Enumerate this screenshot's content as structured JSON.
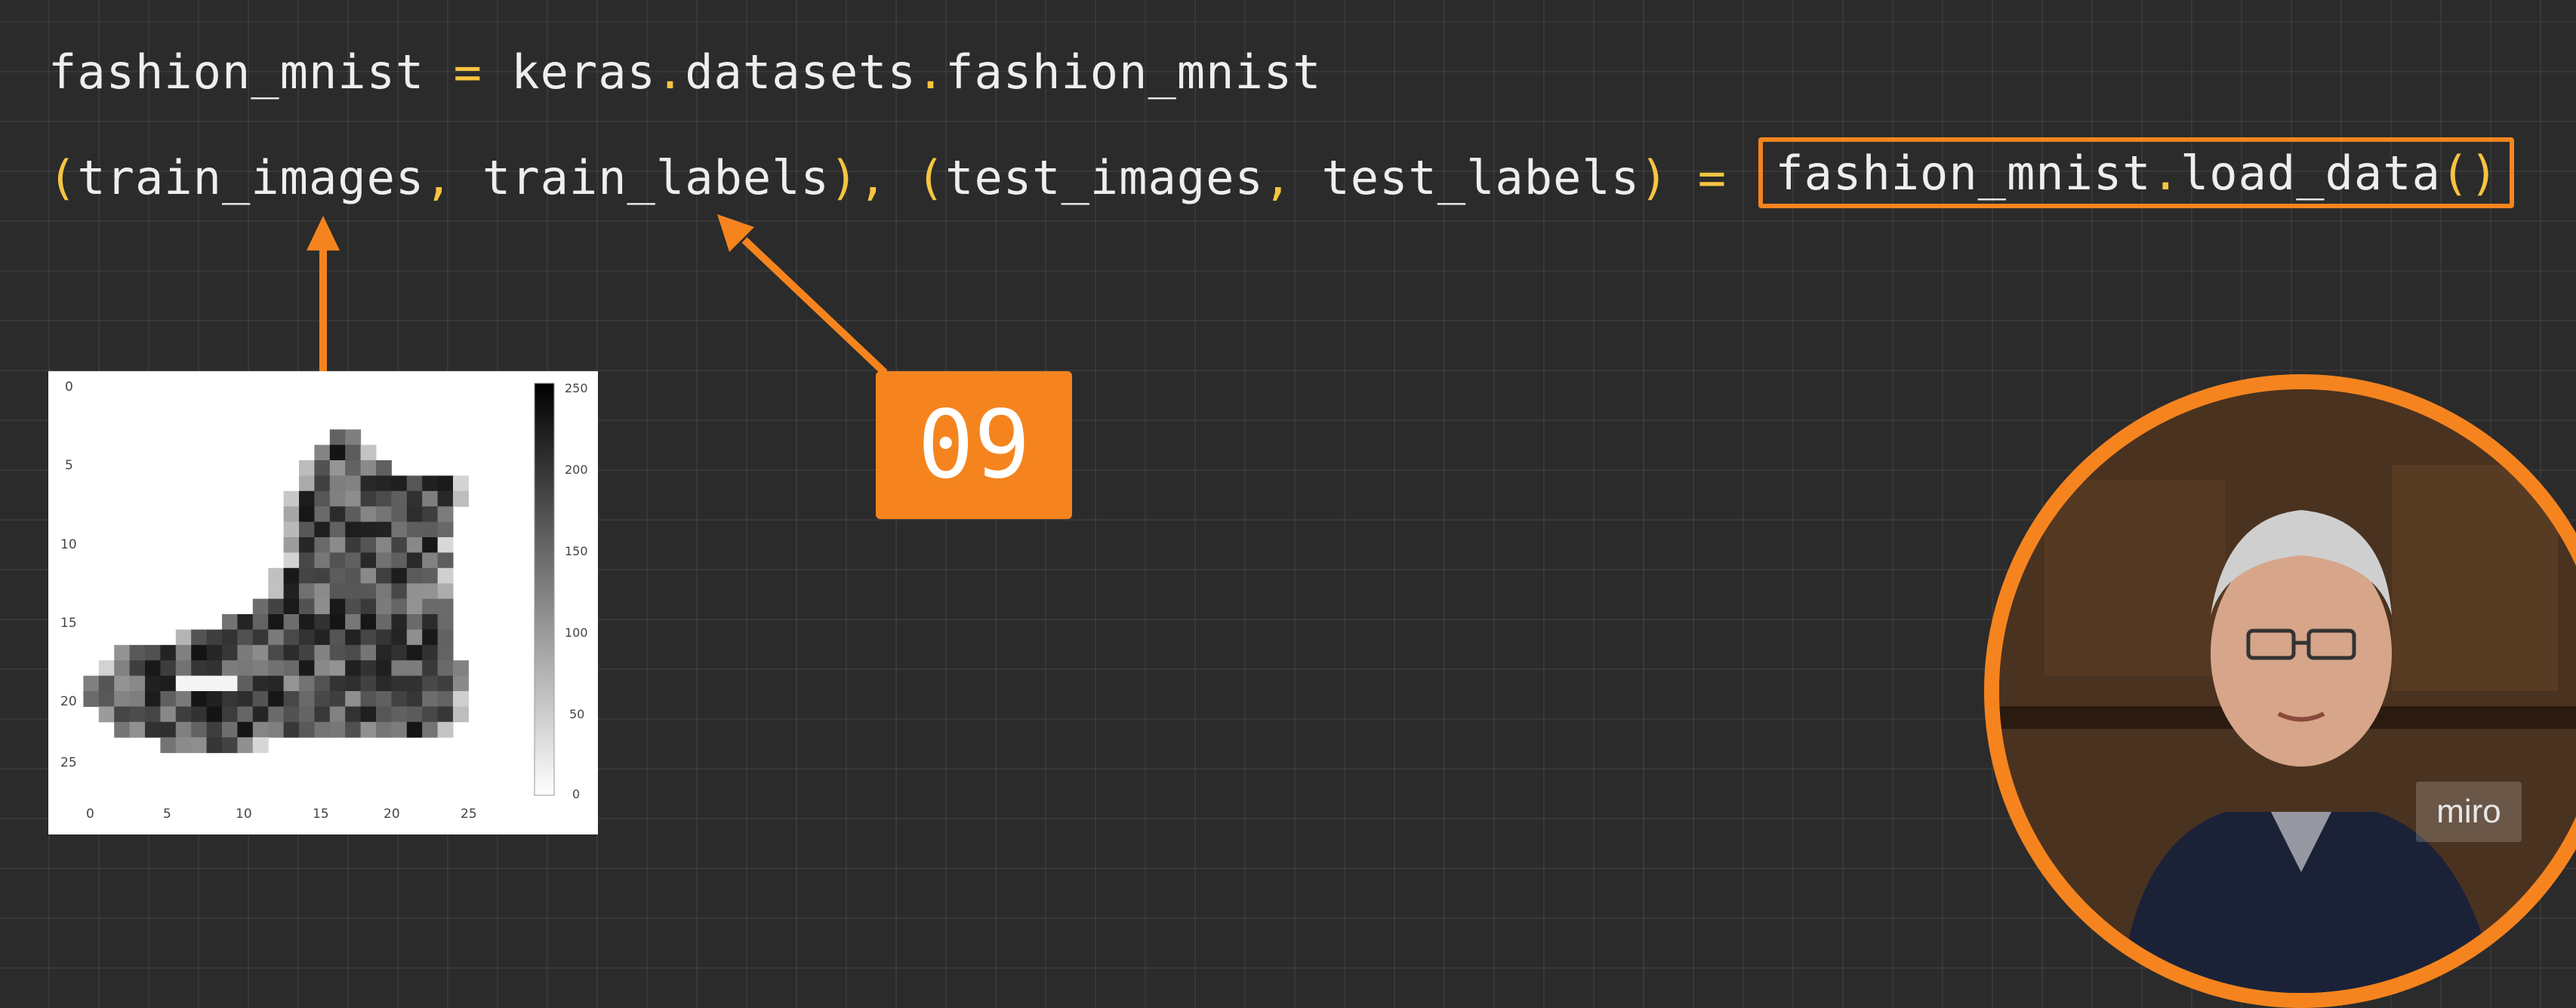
{
  "code": {
    "line1": {
      "var": "fashion_mnist",
      "eq": "=",
      "mod1": "keras",
      "dot": ".",
      "mod2": "datasets",
      "attr": "fashion_mnist"
    },
    "line2": {
      "open_paren": "(",
      "close_paren": ")",
      "comma": ",",
      "train_images": "train_images",
      "train_labels": "train_labels",
      "test_images": "test_images",
      "test_labels": "test_labels",
      "eq": "=",
      "call_obj": "fashion_mnist",
      "dot": ".",
      "call_fn": "load_data",
      "call_parens": "()"
    }
  },
  "badge": {
    "label": "09"
  },
  "image": {
    "description_type": "pixel-art boot",
    "y_ticks": [
      "0",
      "5",
      "10",
      "15",
      "20",
      "25"
    ],
    "x_ticks": [
      "0",
      "5",
      "10",
      "15",
      "20",
      "25"
    ],
    "colorbar_ticks": [
      "250",
      "200",
      "150",
      "100",
      "50",
      "0"
    ]
  },
  "watermark": {
    "label": "miro"
  },
  "colors": {
    "background": "#2b2b2b",
    "code_text": "#eeeeee",
    "punctuation": "#f6c441",
    "accent": "#f5841f"
  },
  "icons": {
    "arrow_up": "arrow-up-icon",
    "arrow_diag": "arrow-diagonal-icon"
  }
}
